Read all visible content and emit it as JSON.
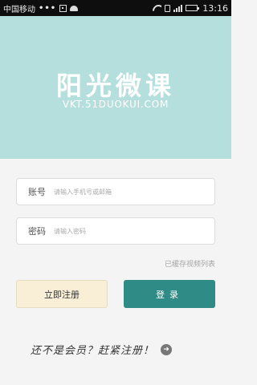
{
  "status_bar": {
    "carrier": "中国移动",
    "dots": "•••",
    "time": "13:16"
  },
  "header": {
    "title": "阳光微课",
    "url": "VKT.51DUOKUI.COM",
    "background_color": "#b4dfdc"
  },
  "form": {
    "account_label": "账号",
    "account_placeholder": "请输入手机号或邮箱",
    "password_label": "密码",
    "password_placeholder": "请输入密码",
    "cached_videos_link": "已缓存视频列表"
  },
  "buttons": {
    "register_label": "立即注册",
    "login_label": "登录",
    "login_color": "#2e8b86",
    "register_color": "#f8efd6"
  },
  "promo": {
    "text": "还不是会员？赶紧注册！",
    "icon": "arrow-right-icon"
  }
}
